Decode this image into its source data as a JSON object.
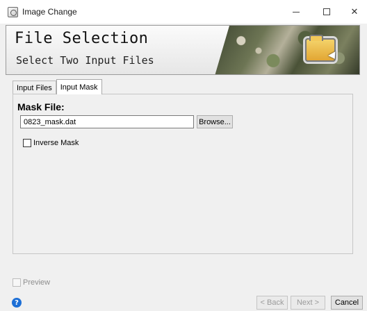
{
  "window": {
    "title": "Image Change",
    "minimize_icon": "minimize-icon",
    "maximize_icon": "maximize-icon",
    "close_glyph": "✕"
  },
  "banner": {
    "title": "File Selection",
    "subtitle": "Select Two Input Files",
    "graphic_icon": "satellite-image-folder-icon"
  },
  "tabs": [
    {
      "label": "Input Files",
      "active": false
    },
    {
      "label": "Input Mask",
      "active": true
    }
  ],
  "mask": {
    "label": "Mask File:",
    "file_value": "0823_mask.dat",
    "browse_label": "Browse...",
    "inverse_label": "Inverse Mask",
    "inverse_checked": false
  },
  "footer": {
    "preview_label": "Preview",
    "preview_checked": false,
    "preview_enabled": false,
    "help_glyph": "?",
    "back_label": "< Back",
    "next_label": "Next >",
    "cancel_label": "Cancel"
  },
  "colors": {
    "help_icon": "#1d6fd6",
    "disabled_text": "#9a9a9a"
  }
}
